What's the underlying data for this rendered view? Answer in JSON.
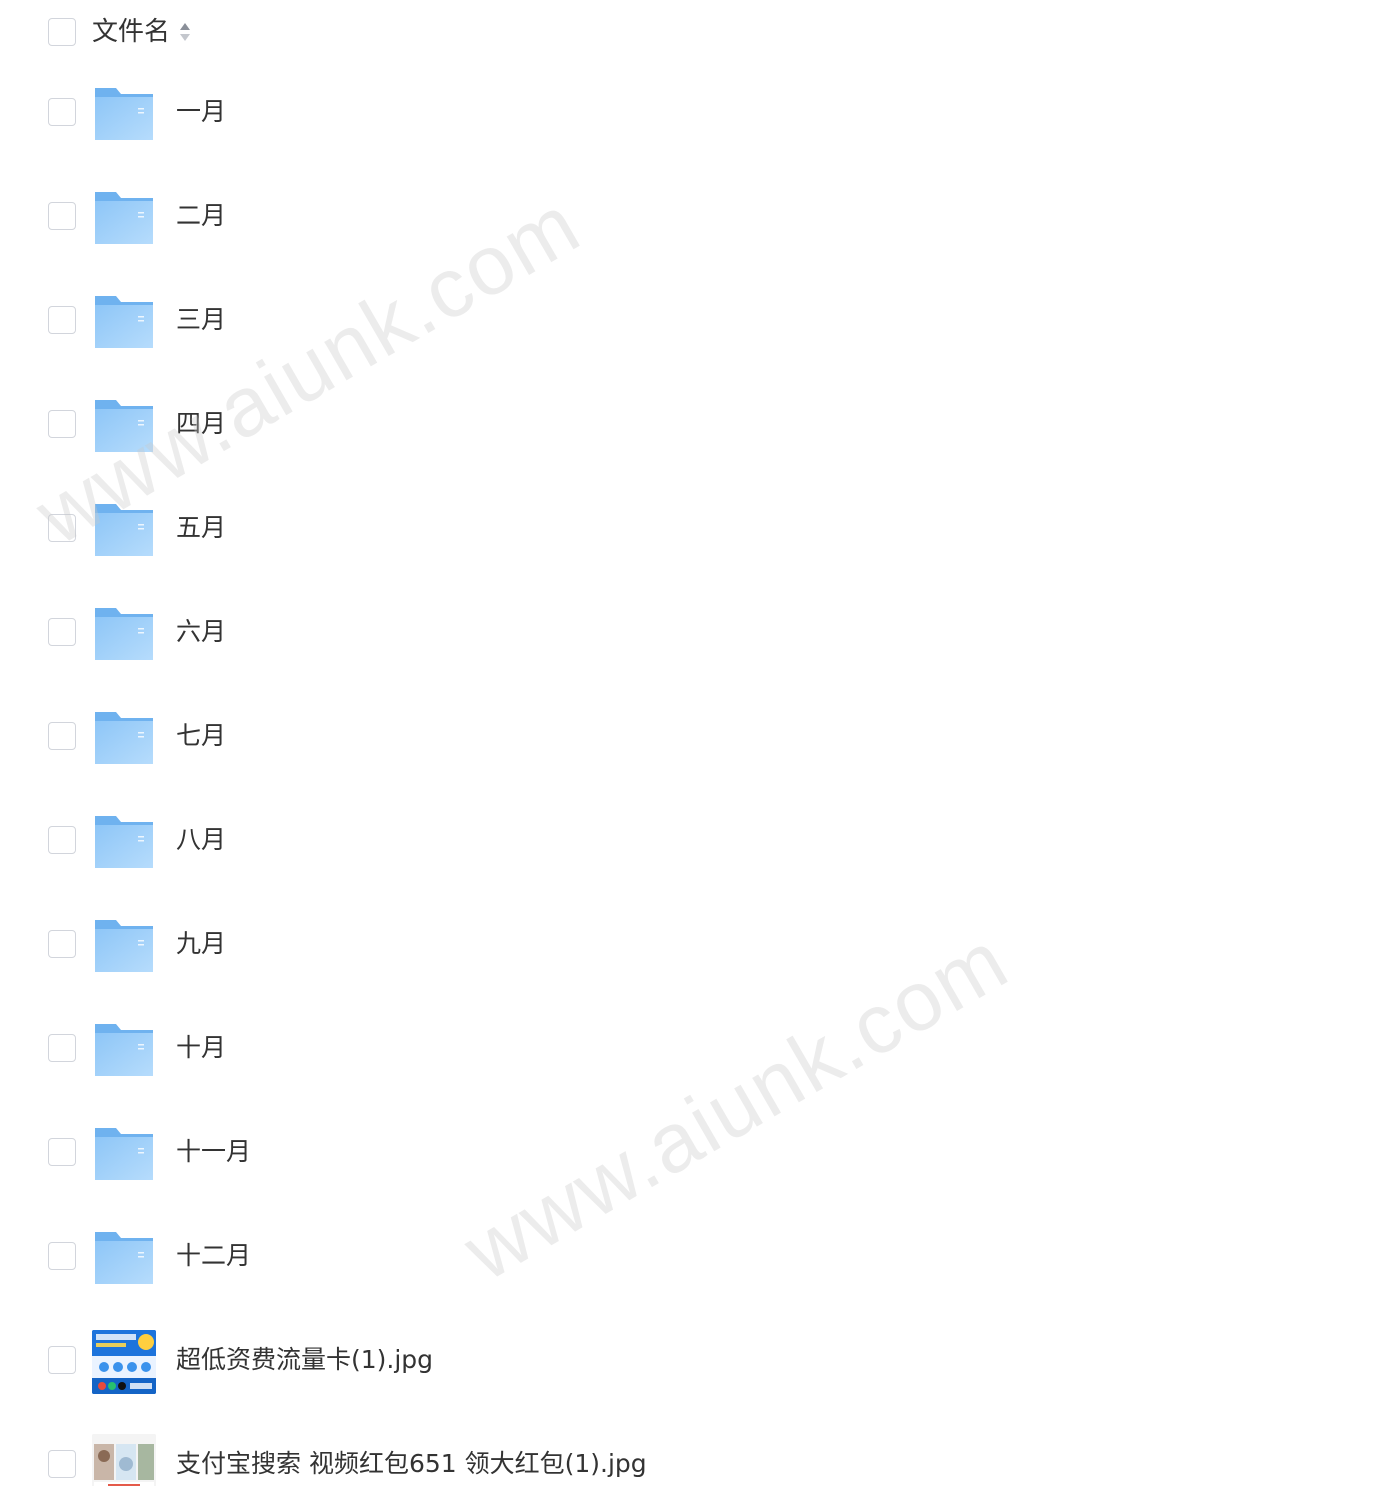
{
  "header": {
    "column_label": "文件名"
  },
  "folders": [
    {
      "name": "一月"
    },
    {
      "name": "二月"
    },
    {
      "name": "三月"
    },
    {
      "name": "四月"
    },
    {
      "name": "五月"
    },
    {
      "name": "六月"
    },
    {
      "name": "七月"
    },
    {
      "name": "八月"
    },
    {
      "name": "九月"
    },
    {
      "name": "十月"
    },
    {
      "name": "十一月"
    },
    {
      "name": "十二月"
    }
  ],
  "files": [
    {
      "name": "超低资费流量卡(1).jpg",
      "icon": "image-thumbnail-icon"
    },
    {
      "name": "支付宝搜索 视频红包651 领大红包(1).jpg",
      "icon": "image-thumbnail-icon"
    }
  ],
  "watermark": {
    "text": "www.aiunk.com"
  },
  "colors": {
    "folder_light": "#a9d4fb",
    "folder_dark": "#6fb2ef",
    "text": "#333333",
    "checkbox_border": "#d2d5dc"
  }
}
